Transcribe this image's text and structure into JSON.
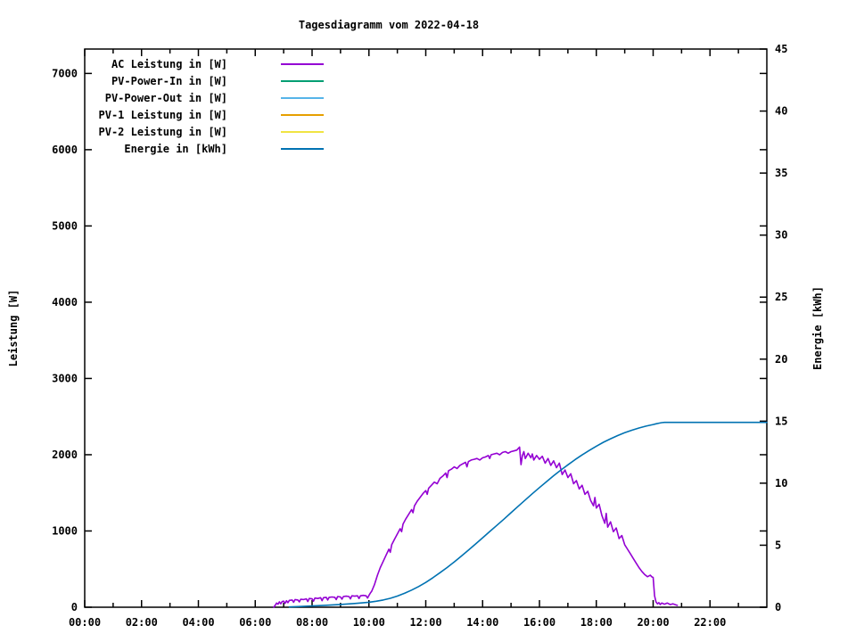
{
  "chart_data": {
    "type": "line",
    "title": "Tagesdiagramm vom 2022-04-18",
    "xlabel": "",
    "x_axis": {
      "range_hours": [
        0,
        24
      ],
      "major_tick_hours": [
        0,
        2,
        4,
        6,
        8,
        10,
        12,
        14,
        16,
        18,
        20,
        22
      ],
      "major_tick_labels": [
        "00:00",
        "02:00",
        "04:00",
        "06:00",
        "08:00",
        "10:00",
        "12:00",
        "14:00",
        "16:00",
        "18:00",
        "20:00",
        "22:00"
      ],
      "minor_tick_hours": [
        1,
        3,
        5,
        7,
        9,
        11,
        13,
        15,
        17,
        19,
        21,
        23
      ]
    },
    "y_left": {
      "label": "Leistung [W]",
      "range": [
        0,
        7320
      ],
      "ticks": [
        0,
        1000,
        2000,
        3000,
        4000,
        5000,
        6000,
        7000
      ],
      "tick_labels": [
        "0",
        "1000",
        "2000",
        "3000",
        "4000",
        "5000",
        "6000",
        "7000"
      ]
    },
    "y_right": {
      "label": "Energie [kWh]",
      "range": [
        0,
        45
      ],
      "ticks": [
        0,
        5,
        10,
        15,
        20,
        25,
        30,
        35,
        40,
        45
      ],
      "tick_labels": [
        "0",
        "5",
        "10",
        "15",
        "20",
        "25",
        "30",
        "35",
        "40",
        "45"
      ]
    },
    "grid": false,
    "legend_position": "top-left-inside",
    "legend": [
      {
        "label": "AC Leistung in [W]",
        "color": "#9400d3"
      },
      {
        "label": "PV-Power-In in [W]",
        "color": "#009e73"
      },
      {
        "label": "PV-Power-Out in [W]",
        "color": "#56b4e9"
      },
      {
        "label": "PV-1 Leistung in [W]",
        "color": "#e69f00"
      },
      {
        "label": "PV-2 Leistung in [W]",
        "color": "#f0e442"
      },
      {
        "label": "Energie in [kWh]",
        "color": "#0072b2"
      }
    ],
    "series": [
      {
        "name": "AC Leistung in [W]",
        "color": "#9400d3",
        "axis": "left",
        "points": [
          [
            6.65,
            0
          ],
          [
            6.7,
            25
          ],
          [
            6.75,
            55
          ],
          [
            6.8,
            40
          ],
          [
            6.85,
            70
          ],
          [
            6.9,
            45
          ],
          [
            6.95,
            75
          ],
          [
            7.0,
            80
          ],
          [
            7.05,
            50
          ],
          [
            7.1,
            85
          ],
          [
            7.15,
            60
          ],
          [
            7.2,
            90
          ],
          [
            7.3,
            95
          ],
          [
            7.35,
            65
          ],
          [
            7.4,
            100
          ],
          [
            7.5,
            95
          ],
          [
            7.55,
            70
          ],
          [
            7.6,
            105
          ],
          [
            7.7,
            100
          ],
          [
            7.8,
            110
          ],
          [
            7.85,
            75
          ],
          [
            7.9,
            115
          ],
          [
            8.0,
            110
          ],
          [
            8.05,
            80
          ],
          [
            8.1,
            120
          ],
          [
            8.2,
            115
          ],
          [
            8.3,
            125
          ],
          [
            8.35,
            85
          ],
          [
            8.4,
            125
          ],
          [
            8.5,
            130
          ],
          [
            8.55,
            95
          ],
          [
            8.6,
            130
          ],
          [
            8.7,
            135
          ],
          [
            8.8,
            130
          ],
          [
            8.85,
            100
          ],
          [
            8.9,
            140
          ],
          [
            9.0,
            135
          ],
          [
            9.05,
            105
          ],
          [
            9.1,
            140
          ],
          [
            9.2,
            145
          ],
          [
            9.3,
            140
          ],
          [
            9.35,
            110
          ],
          [
            9.4,
            150
          ],
          [
            9.5,
            145
          ],
          [
            9.6,
            150
          ],
          [
            9.65,
            115
          ],
          [
            9.7,
            150
          ],
          [
            9.8,
            155
          ],
          [
            9.9,
            150
          ],
          [
            9.95,
            120
          ],
          [
            10.0,
            155
          ],
          [
            10.05,
            185
          ],
          [
            10.1,
            210
          ],
          [
            10.2,
            300
          ],
          [
            10.3,
            420
          ],
          [
            10.4,
            520
          ],
          [
            10.5,
            600
          ],
          [
            10.6,
            680
          ],
          [
            10.7,
            760
          ],
          [
            10.75,
            720
          ],
          [
            10.8,
            820
          ],
          [
            10.9,
            890
          ],
          [
            11.0,
            960
          ],
          [
            11.1,
            1030
          ],
          [
            11.15,
            990
          ],
          [
            11.2,
            1090
          ],
          [
            11.3,
            1160
          ],
          [
            11.4,
            1220
          ],
          [
            11.5,
            1280
          ],
          [
            11.55,
            1240
          ],
          [
            11.6,
            1330
          ],
          [
            11.7,
            1390
          ],
          [
            11.8,
            1440
          ],
          [
            11.9,
            1490
          ],
          [
            12.0,
            1530
          ],
          [
            12.05,
            1480
          ],
          [
            12.1,
            1560
          ],
          [
            12.2,
            1600
          ],
          [
            12.3,
            1640
          ],
          [
            12.4,
            1620
          ],
          [
            12.5,
            1690
          ],
          [
            12.6,
            1720
          ],
          [
            12.7,
            1760
          ],
          [
            12.75,
            1700
          ],
          [
            12.8,
            1790
          ],
          [
            12.9,
            1810
          ],
          [
            13.0,
            1840
          ],
          [
            13.1,
            1820
          ],
          [
            13.2,
            1860
          ],
          [
            13.3,
            1880
          ],
          [
            13.4,
            1900
          ],
          [
            13.45,
            1840
          ],
          [
            13.5,
            1910
          ],
          [
            13.6,
            1930
          ],
          [
            13.7,
            1940
          ],
          [
            13.8,
            1950
          ],
          [
            13.9,
            1930
          ],
          [
            14.0,
            1960
          ],
          [
            14.1,
            1970
          ],
          [
            14.2,
            1990
          ],
          [
            14.25,
            1950
          ],
          [
            14.3,
            2000
          ],
          [
            14.4,
            2010
          ],
          [
            14.5,
            2020
          ],
          [
            14.6,
            2000
          ],
          [
            14.7,
            2030
          ],
          [
            14.8,
            2040
          ],
          [
            14.9,
            2020
          ],
          [
            15.0,
            2040
          ],
          [
            15.1,
            2050
          ],
          [
            15.2,
            2060
          ],
          [
            15.3,
            2100
          ],
          [
            15.35,
            1870
          ],
          [
            15.4,
            1990
          ],
          [
            15.45,
            2040
          ],
          [
            15.5,
            1950
          ],
          [
            15.6,
            2020
          ],
          [
            15.7,
            1960
          ],
          [
            15.75,
            2010
          ],
          [
            15.8,
            1930
          ],
          [
            15.9,
            1990
          ],
          [
            16.0,
            1940
          ],
          [
            16.1,
            1980
          ],
          [
            16.2,
            1890
          ],
          [
            16.3,
            1950
          ],
          [
            16.4,
            1860
          ],
          [
            16.5,
            1920
          ],
          [
            16.6,
            1830
          ],
          [
            16.7,
            1890
          ],
          [
            16.8,
            1740
          ],
          [
            16.9,
            1800
          ],
          [
            17.0,
            1700
          ],
          [
            17.1,
            1750
          ],
          [
            17.2,
            1620
          ],
          [
            17.3,
            1660
          ],
          [
            17.4,
            1550
          ],
          [
            17.5,
            1600
          ],
          [
            17.6,
            1480
          ],
          [
            17.7,
            1520
          ],
          [
            17.8,
            1400
          ],
          [
            17.9,
            1330
          ],
          [
            17.95,
            1440
          ],
          [
            18.0,
            1300
          ],
          [
            18.1,
            1350
          ],
          [
            18.2,
            1200
          ],
          [
            18.3,
            1100
          ],
          [
            18.35,
            1230
          ],
          [
            18.4,
            1050
          ],
          [
            18.5,
            1120
          ],
          [
            18.6,
            990
          ],
          [
            18.7,
            1040
          ],
          [
            18.8,
            900
          ],
          [
            18.9,
            940
          ],
          [
            19.0,
            820
          ],
          [
            19.1,
            760
          ],
          [
            19.2,
            700
          ],
          [
            19.3,
            640
          ],
          [
            19.4,
            580
          ],
          [
            19.5,
            520
          ],
          [
            19.6,
            470
          ],
          [
            19.7,
            430
          ],
          [
            19.8,
            400
          ],
          [
            19.9,
            420
          ],
          [
            19.95,
            400
          ],
          [
            20.0,
            390
          ],
          [
            20.05,
            150
          ],
          [
            20.1,
            70
          ],
          [
            20.15,
            45
          ],
          [
            20.2,
            60
          ],
          [
            20.25,
            35
          ],
          [
            20.3,
            55
          ],
          [
            20.4,
            40
          ],
          [
            20.5,
            55
          ],
          [
            20.6,
            35
          ],
          [
            20.7,
            45
          ],
          [
            20.8,
            30
          ],
          [
            20.85,
            25
          ]
        ]
      },
      {
        "name": "Energie in [kWh]",
        "color": "#0072b2",
        "axis": "right",
        "points": [
          [
            7.2,
            0.02
          ],
          [
            7.5,
            0.05
          ],
          [
            8.0,
            0.1
          ],
          [
            8.5,
            0.16
          ],
          [
            9.0,
            0.22
          ],
          [
            9.5,
            0.3
          ],
          [
            10.0,
            0.4
          ],
          [
            10.25,
            0.48
          ],
          [
            10.5,
            0.58
          ],
          [
            10.75,
            0.72
          ],
          [
            11.0,
            0.9
          ],
          [
            11.25,
            1.12
          ],
          [
            11.5,
            1.38
          ],
          [
            11.75,
            1.67
          ],
          [
            12.0,
            2.0
          ],
          [
            12.25,
            2.38
          ],
          [
            12.5,
            2.78
          ],
          [
            12.75,
            3.2
          ],
          [
            13.0,
            3.65
          ],
          [
            13.25,
            4.12
          ],
          [
            13.5,
            4.6
          ],
          [
            13.75,
            5.1
          ],
          [
            14.0,
            5.6
          ],
          [
            14.25,
            6.1
          ],
          [
            14.5,
            6.6
          ],
          [
            14.75,
            7.1
          ],
          [
            15.0,
            7.62
          ],
          [
            15.25,
            8.14
          ],
          [
            15.5,
            8.65
          ],
          [
            15.75,
            9.15
          ],
          [
            16.0,
            9.65
          ],
          [
            16.25,
            10.13
          ],
          [
            16.5,
            10.6
          ],
          [
            16.75,
            11.05
          ],
          [
            17.0,
            11.48
          ],
          [
            17.25,
            11.89
          ],
          [
            17.5,
            12.28
          ],
          [
            17.75,
            12.64
          ],
          [
            18.0,
            12.98
          ],
          [
            18.25,
            13.3
          ],
          [
            18.5,
            13.58
          ],
          [
            18.75,
            13.84
          ],
          [
            19.0,
            14.07
          ],
          [
            19.25,
            14.27
          ],
          [
            19.5,
            14.45
          ],
          [
            19.75,
            14.6
          ],
          [
            20.0,
            14.73
          ],
          [
            20.1,
            14.79
          ],
          [
            20.2,
            14.84
          ],
          [
            20.3,
            14.88
          ],
          [
            20.4,
            14.9
          ],
          [
            21.0,
            14.9
          ],
          [
            22.0,
            14.9
          ],
          [
            24.0,
            14.9
          ]
        ]
      }
    ]
  }
}
